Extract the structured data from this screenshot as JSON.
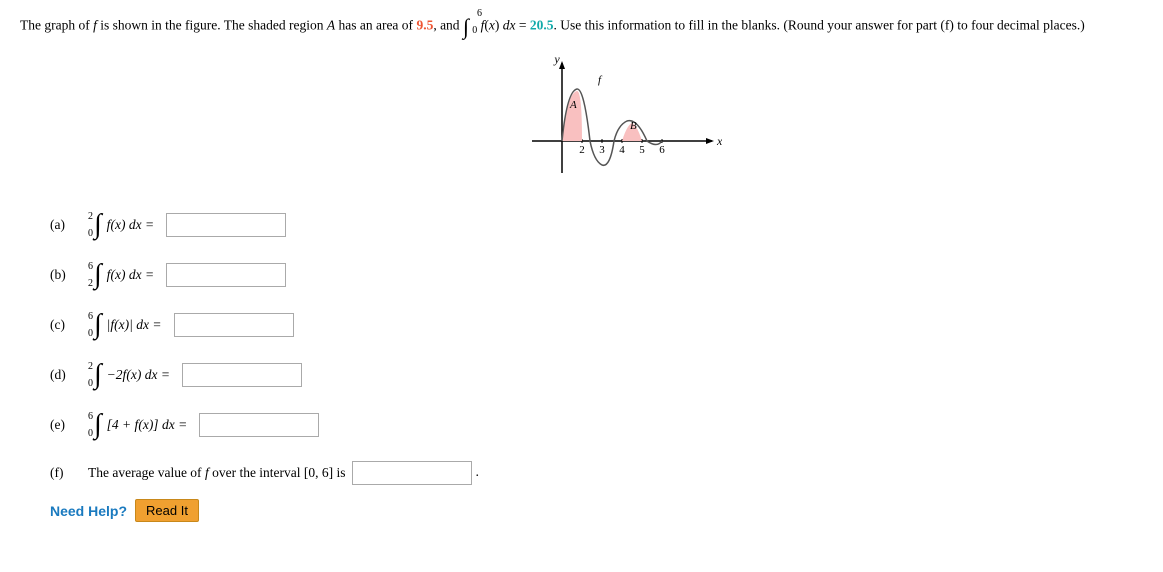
{
  "header": {
    "text_start": "The graph of ",
    "f_italic": "f",
    "text_mid1": " is shown in the figure. The shaded region ",
    "A_italic": "A",
    "text_mid2": " has an area of ",
    "area_value": "9.5",
    "text_and": ", and ",
    "integral_upper": "6",
    "integral_lower": "0",
    "integral_text": "f(x) dx = ",
    "integral_value": "20.5",
    "text_end": ". Use this information to fill in the blanks. (Round your answer for part (f) to four decimal places.)"
  },
  "graph": {
    "y_label": "y",
    "x_label": "x",
    "A_label": "A",
    "f_label": "f",
    "B_label": "B",
    "x_ticks": [
      "2",
      "3",
      "4",
      "5",
      "6"
    ]
  },
  "problems": [
    {
      "id": "a",
      "label": "(a)",
      "lower": "0",
      "upper": "2",
      "integrand": "f(x) dx =",
      "placeholder": ""
    },
    {
      "id": "b",
      "label": "(b)",
      "lower": "2",
      "upper": "6",
      "integrand": "f(x) dx =",
      "placeholder": ""
    },
    {
      "id": "c",
      "label": "(c)",
      "lower": "0",
      "upper": "6",
      "integrand": "|f(x)| dx =",
      "placeholder": ""
    },
    {
      "id": "d",
      "label": "(d)",
      "lower": "0",
      "upper": "2",
      "integrand": "-2f(x) dx =",
      "placeholder": ""
    },
    {
      "id": "e",
      "label": "(e)",
      "lower": "0",
      "upper": "6",
      "integrand": "[4 + f(x)] dx =",
      "placeholder": ""
    }
  ],
  "part_f": {
    "label": "(f)",
    "text": "The average value of ",
    "f_italic": "f",
    "text2": " over the interval [0, 6] is",
    "placeholder": ""
  },
  "footer": {
    "need_help": "Need Help?",
    "read_it": "Read It"
  }
}
